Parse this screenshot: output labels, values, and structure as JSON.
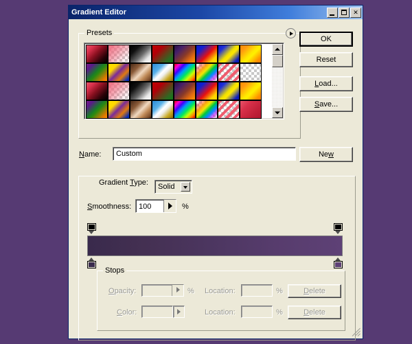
{
  "window": {
    "title": "Gradient Editor",
    "controls": [
      {
        "name": "minimize-button",
        "glyph": "_"
      },
      {
        "name": "maximize-button",
        "glyph": "□"
      },
      {
        "name": "close-button",
        "glyph": "✕"
      }
    ]
  },
  "presets": {
    "title": "Presets",
    "menu_icon": "right-triangle-icon",
    "scrollbar": {
      "up": "scroll-up-arrow",
      "down": "scroll-down-arrow"
    },
    "swatches": [
      {
        "name": "foreground-to-background",
        "css": "linear-gradient(135deg,#e8536a 0%,#d8304a 22%,#8a1020 48%,#2a0208 78%,#000000 100%)"
      },
      {
        "name": "foreground-to-transparent",
        "checker": true,
        "css": "linear-gradient(135deg,#f06a7f 0%,rgba(240,106,127,0.55) 45%,rgba(240,106,127,0.12) 78%,rgba(240,106,127,0) 100%)"
      },
      {
        "name": "black-white",
        "css": "linear-gradient(135deg,#000000 0%,#101010 25%,#6a6a6a 55%,#e8e8e8 80%,#ffffff 100%)"
      },
      {
        "name": "red-green",
        "css": "linear-gradient(135deg,#c40000 0%,#b00008 30%,#6a3a18 55%,#2d6a22 80%,#0f7a16 100%)"
      },
      {
        "name": "violet-orange",
        "css": "linear-gradient(135deg,#2a1040 0%,#45206a 25%,#8a3a28 55%,#e06a10 78%,#ff9a00 100%)"
      },
      {
        "name": "blue-red-yellow",
        "css": "linear-gradient(135deg,#0a18c8 0%,#1020d0 22%,#e81010 55%,#ffd200 82%,#ffe000 100%)"
      },
      {
        "name": "blue-yellow-blue",
        "css": "linear-gradient(135deg,#0a18c8 0%,#2030d8 20%,#f0e000 50%,#ffe800 60%,#1020c0 88%,#0a18b0 100%)"
      },
      {
        "name": "orange-yellow-orange",
        "css": "linear-gradient(135deg,#ff8a00 0%,#ff9a10 20%,#ffe800 50%,#fff000 58%,#ff9000 86%,#ff8000 100%)"
      },
      {
        "name": "violet-green-orange",
        "css": "linear-gradient(135deg,#7a1a8a 0%,#5a1a8a 18%,#1a7a2a 45%,#2a8a10 55%,#e07a00 86%,#ff8a00 100%)"
      },
      {
        "name": "yellow-violet-orange-blue",
        "css": "linear-gradient(135deg,#ffe000 0%,#ffd800 25%,#7a2a9a 48%,#e07a10 70%,#0a30b8 92%,#0a28a8 100%)"
      },
      {
        "name": "copper",
        "css": "linear-gradient(135deg,#4a2a18 0%,#8a5a38 28%,#f0d8c0 52%,#c08a58 72%,#7a4a28 92%,#3a2010 100%)"
      },
      {
        "name": "chrome",
        "css": "linear-gradient(135deg,#2a8ad8 0%,#58b0e8 30%,#ffffff 48%,#f0f0f0 58%,#c8a820 80%,#8a6a10 100%)"
      },
      {
        "name": "spectrum",
        "css": "linear-gradient(135deg,#e80000 0%,#ff00d0 14%,#4000ff 28%,#0098ff 42%,#00e860 58%,#c8ff00 74%,#ff8000 88%,#e80000 100%)"
      },
      {
        "name": "transparent-rainbow",
        "checker": true,
        "css": "linear-gradient(135deg,rgba(232,0,0,0) 4%,rgba(255,0,0,0.35) 16%,rgba(255,160,0,0.9) 30%,rgba(240,230,0,1) 42%,rgba(0,200,60,1) 56%,rgba(0,140,255,1) 70%,rgba(200,0,255,0.6) 84%,rgba(232,0,200,0) 98%)"
      },
      {
        "name": "transparent-stripes",
        "checker": true,
        "css": "repeating-linear-gradient(135deg,rgba(240,80,100,0.92) 0 4px,rgba(255,255,255,0) 4px 8px)"
      },
      {
        "name": "transparent-checkerboard",
        "checker": true,
        "css": "linear-gradient(135deg,rgba(255,255,255,0) 0%,rgba(255,255,255,0) 100%)"
      },
      {
        "name": "foreground-to-background-2",
        "css": "linear-gradient(135deg,#e8536a 0%,#d8304a 22%,#8a1020 48%,#2a0208 78%,#000000 100%)"
      },
      {
        "name": "foreground-to-transparent-2",
        "checker": true,
        "css": "linear-gradient(135deg,#f06a7f 0%,rgba(240,106,127,0.55) 45%,rgba(240,106,127,0.12) 78%,rgba(240,106,127,0) 100%)"
      },
      {
        "name": "black-white-2",
        "css": "linear-gradient(135deg,#000000 0%,#101010 25%,#6a6a6a 55%,#e8e8e8 80%,#ffffff 100%)"
      },
      {
        "name": "red-green-2",
        "css": "linear-gradient(135deg,#c40000 0%,#b00008 30%,#6a3a18 55%,#2d6a22 80%,#0f7a16 100%)"
      },
      {
        "name": "violet-orange-2",
        "css": "linear-gradient(135deg,#2a1040 0%,#45206a 25%,#8a3a28 55%,#e06a10 78%,#ff9a00 100%)"
      },
      {
        "name": "blue-red-yellow-2",
        "css": "linear-gradient(135deg,#0a18c8 0%,#1020d0 22%,#e81010 55%,#ffd200 82%,#ffe000 100%)"
      },
      {
        "name": "blue-yellow-blue-2",
        "css": "linear-gradient(135deg,#0a18c8 0%,#2030d8 20%,#f0e000 50%,#ffe800 60%,#1020c0 88%,#0a18b0 100%)"
      },
      {
        "name": "orange-yellow-orange-2",
        "css": "linear-gradient(135deg,#ff8a00 0%,#ff9a10 20%,#ffe800 50%,#fff000 58%,#ff9000 86%,#ff8000 100%)"
      },
      {
        "name": "violet-green-orange-2",
        "css": "linear-gradient(135deg,#7a1a8a 0%,#5a1a8a 18%,#1a7a2a 45%,#2a8a10 55%,#e07a00 86%,#ff8a00 100%)"
      },
      {
        "name": "yellow-violet-orange-blue-2",
        "css": "linear-gradient(135deg,#ffe000 0%,#ffd800 25%,#7a2a9a 48%,#e07a10 70%,#0a30b8 92%,#0a28a8 100%)"
      },
      {
        "name": "copper-2",
        "css": "linear-gradient(135deg,#4a2a18 0%,#8a5a38 28%,#f0d8c0 52%,#c08a58 72%,#7a4a28 92%,#3a2010 100%)"
      },
      {
        "name": "chrome-2",
        "css": "linear-gradient(135deg,#2a8ad8 0%,#58b0e8 30%,#ffffff 48%,#f0f0f0 58%,#c8a820 80%,#8a6a10 100%)"
      },
      {
        "name": "spectrum-2",
        "css": "linear-gradient(135deg,#e80000 0%,#ff00d0 14%,#4000ff 28%,#0098ff 42%,#00e860 58%,#c8ff00 74%,#ff8000 88%,#e80000 100%)"
      },
      {
        "name": "transparent-rainbow-2",
        "checker": true,
        "css": "linear-gradient(135deg,rgba(232,0,0,0) 4%,rgba(255,0,0,0.35) 16%,rgba(255,160,0,0.9) 30%,rgba(240,230,0,1) 42%,rgba(0,200,60,1) 56%,rgba(0,140,255,1) 70%,rgba(200,0,255,0.6) 84%,rgba(232,0,200,0) 98%)"
      },
      {
        "name": "transparent-stripes-2",
        "checker": true,
        "css": "repeating-linear-gradient(135deg,rgba(240,80,100,0.92) 0 4px,rgba(255,255,255,0) 4px 8px)"
      },
      {
        "name": "foreground-to-background-3",
        "css": "linear-gradient(135deg,#e8536a 0%,#d8304a 30%,#c02038 70%,#b01830 100%)"
      }
    ]
  },
  "buttons": {
    "ok": "OK",
    "reset": "Reset",
    "load": "Load...",
    "load_accel": "L",
    "save": "Save...",
    "save_accel": "S",
    "new": "New",
    "new_accel": "w"
  },
  "name_row": {
    "label": "Name:",
    "label_accel": "N",
    "value": "Custom"
  },
  "gradient_type": {
    "label": "Gradient Type:",
    "label_accel": "T",
    "value": "Solid",
    "arrow_icon": "chevron-down-icon"
  },
  "smoothness": {
    "label": "Smoothness:",
    "label_accel": "S",
    "value": "100",
    "unit": "%",
    "arrow_icon": "right-triangle-icon"
  },
  "gradient_bar": {
    "css": "linear-gradient(to right,#392a4c 0%,#443052 22%,#4c3660 48%,#573c6d 74%,#5e4176 100%)",
    "opacity_stops": [
      {
        "name": "opacity-stop-left",
        "position": 0,
        "color": "#000000"
      },
      {
        "name": "opacity-stop-right",
        "position": 100,
        "color": "#000000"
      }
    ],
    "color_stops": [
      {
        "name": "color-stop-left",
        "position": 0,
        "color": "#3a2b4d"
      },
      {
        "name": "color-stop-right",
        "position": 100,
        "color": "#5e4176"
      }
    ]
  },
  "stops": {
    "title": "Stops",
    "opacity": {
      "label": "Opacity:",
      "value": "",
      "unit": "%",
      "accel": "O"
    },
    "opacity_location": {
      "label": "Location:",
      "value": "",
      "unit": "%"
    },
    "opacity_delete": {
      "label": "Delete",
      "accel": "D"
    },
    "color": {
      "label": "Color:",
      "value": "",
      "accel": "C"
    },
    "color_location": {
      "label": "Location:",
      "value": "",
      "unit": "%"
    },
    "color_delete": {
      "label": "Delete",
      "accel": "D"
    }
  },
  "colors": {
    "desktop": "#563a73",
    "dialog_face": "#ece9d8",
    "titlebar_start": "#0a246a",
    "titlebar_end": "#9fc3ef",
    "gradient_start": "#392a4c",
    "gradient_end": "#5e4176"
  }
}
